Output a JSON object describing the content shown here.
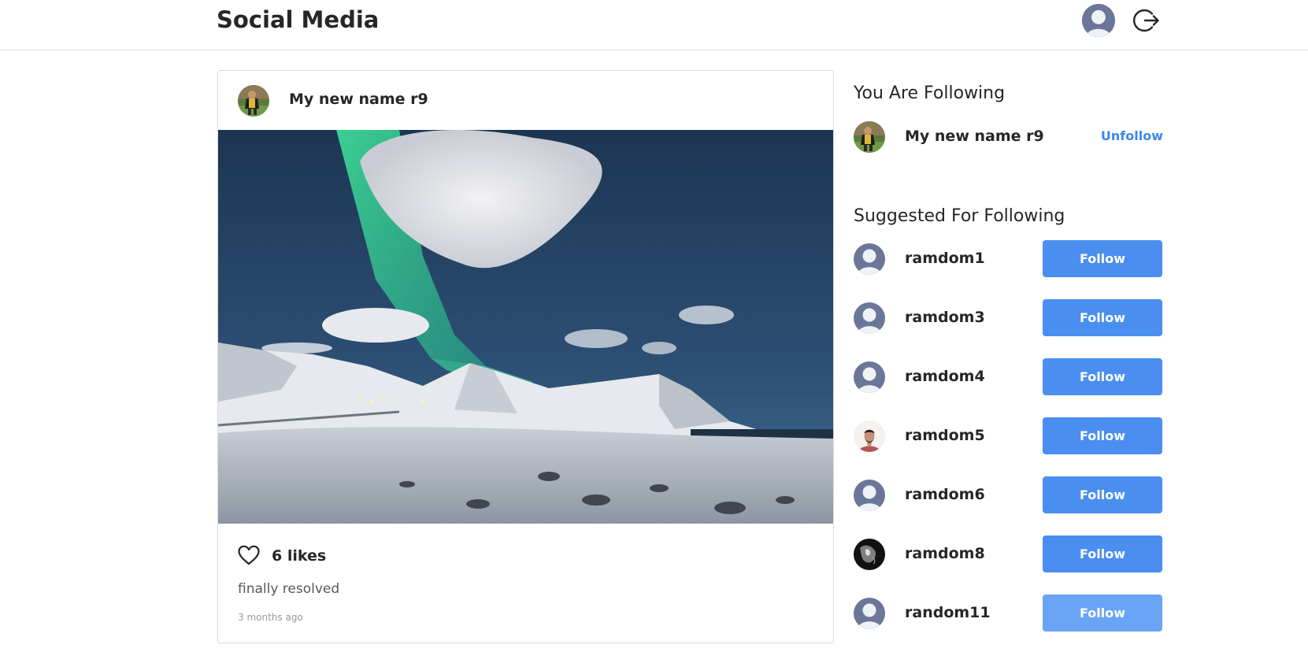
{
  "header": {
    "brand": "Social Media",
    "icons": {
      "avatar": "user-avatar-icon",
      "logout": "logout-icon"
    }
  },
  "post": {
    "author": "My new name r9",
    "likes": "6 likes",
    "caption": "finally resolved",
    "time": "3 months ago",
    "icons": {
      "like": "heart-icon"
    }
  },
  "sidebar": {
    "following_title": "You Are Following",
    "following": [
      {
        "name": "My new name r9",
        "action": "Unfollow"
      }
    ],
    "suggested_title": "Suggested For Following",
    "suggested": [
      {
        "name": "ramdom1",
        "action": "Follow",
        "avatar": "default"
      },
      {
        "name": "ramdom3",
        "action": "Follow",
        "avatar": "default"
      },
      {
        "name": "ramdom4",
        "action": "Follow",
        "avatar": "default"
      },
      {
        "name": "ramdom5",
        "action": "Follow",
        "avatar": "photo-man"
      },
      {
        "name": "ramdom6",
        "action": "Follow",
        "avatar": "default"
      },
      {
        "name": "ramdom8",
        "action": "Follow",
        "avatar": "photo-dark"
      },
      {
        "name": "random11",
        "action": "Follow",
        "avatar": "default"
      }
    ]
  },
  "colors": {
    "accent": "#4a8fef",
    "link": "#3b88ec",
    "text": "#262626",
    "border": "#dbdbdb"
  }
}
